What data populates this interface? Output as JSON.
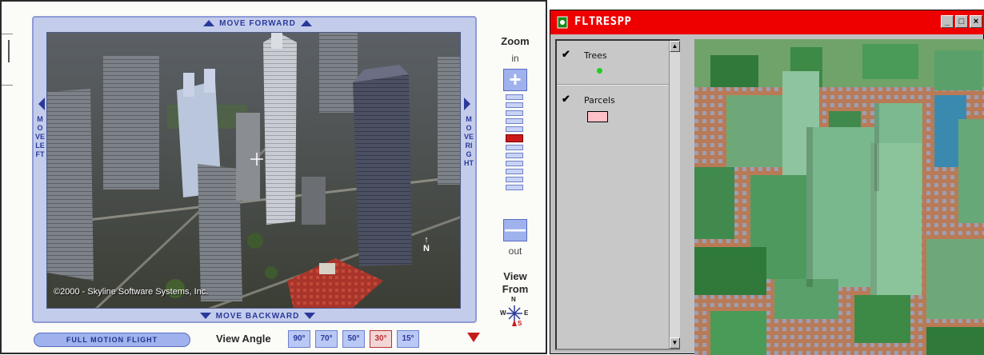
{
  "viewer": {
    "nav": {
      "forward": "MOVE FORWARD",
      "backward": "MOVE BACKWARD",
      "left": "MOVE LEFT",
      "right": "MOVE RIGHT"
    },
    "copyright": "©2000 - Skyline Software Systems, Inc.",
    "map_north_label": "N",
    "zoom": {
      "title": "Zoom",
      "in_label": "in",
      "out_label": "out",
      "plus": "+",
      "minus": "—",
      "levels": 12,
      "current_level": 6
    },
    "view_from": {
      "label": "View From",
      "compass_north": "N",
      "compass_south": "S",
      "compass_west": "W",
      "compass_east": "E"
    },
    "full_motion": "FULL MOTION FLIGHT",
    "view_angle": {
      "label": "View Angle",
      "options": [
        "90°",
        "70°",
        "50°",
        "30°",
        "15°"
      ],
      "selected": "30°"
    },
    "colors": {
      "frame": "#c4ccec",
      "accent": "#2a3a9a",
      "active": "#cc1a1a"
    }
  },
  "gis_window": {
    "title": "FLTRESPP",
    "controls": {
      "minimize": "_",
      "maximize": "□",
      "close": "×"
    },
    "legend": [
      {
        "name": "Trees",
        "checked": true,
        "symbol": "green-dot",
        "color": "#22cc22"
      },
      {
        "name": "Parcels",
        "checked": true,
        "symbol": "pink-box",
        "color": "#ffc0c8"
      }
    ],
    "title_bar_color": "#ee0000"
  }
}
